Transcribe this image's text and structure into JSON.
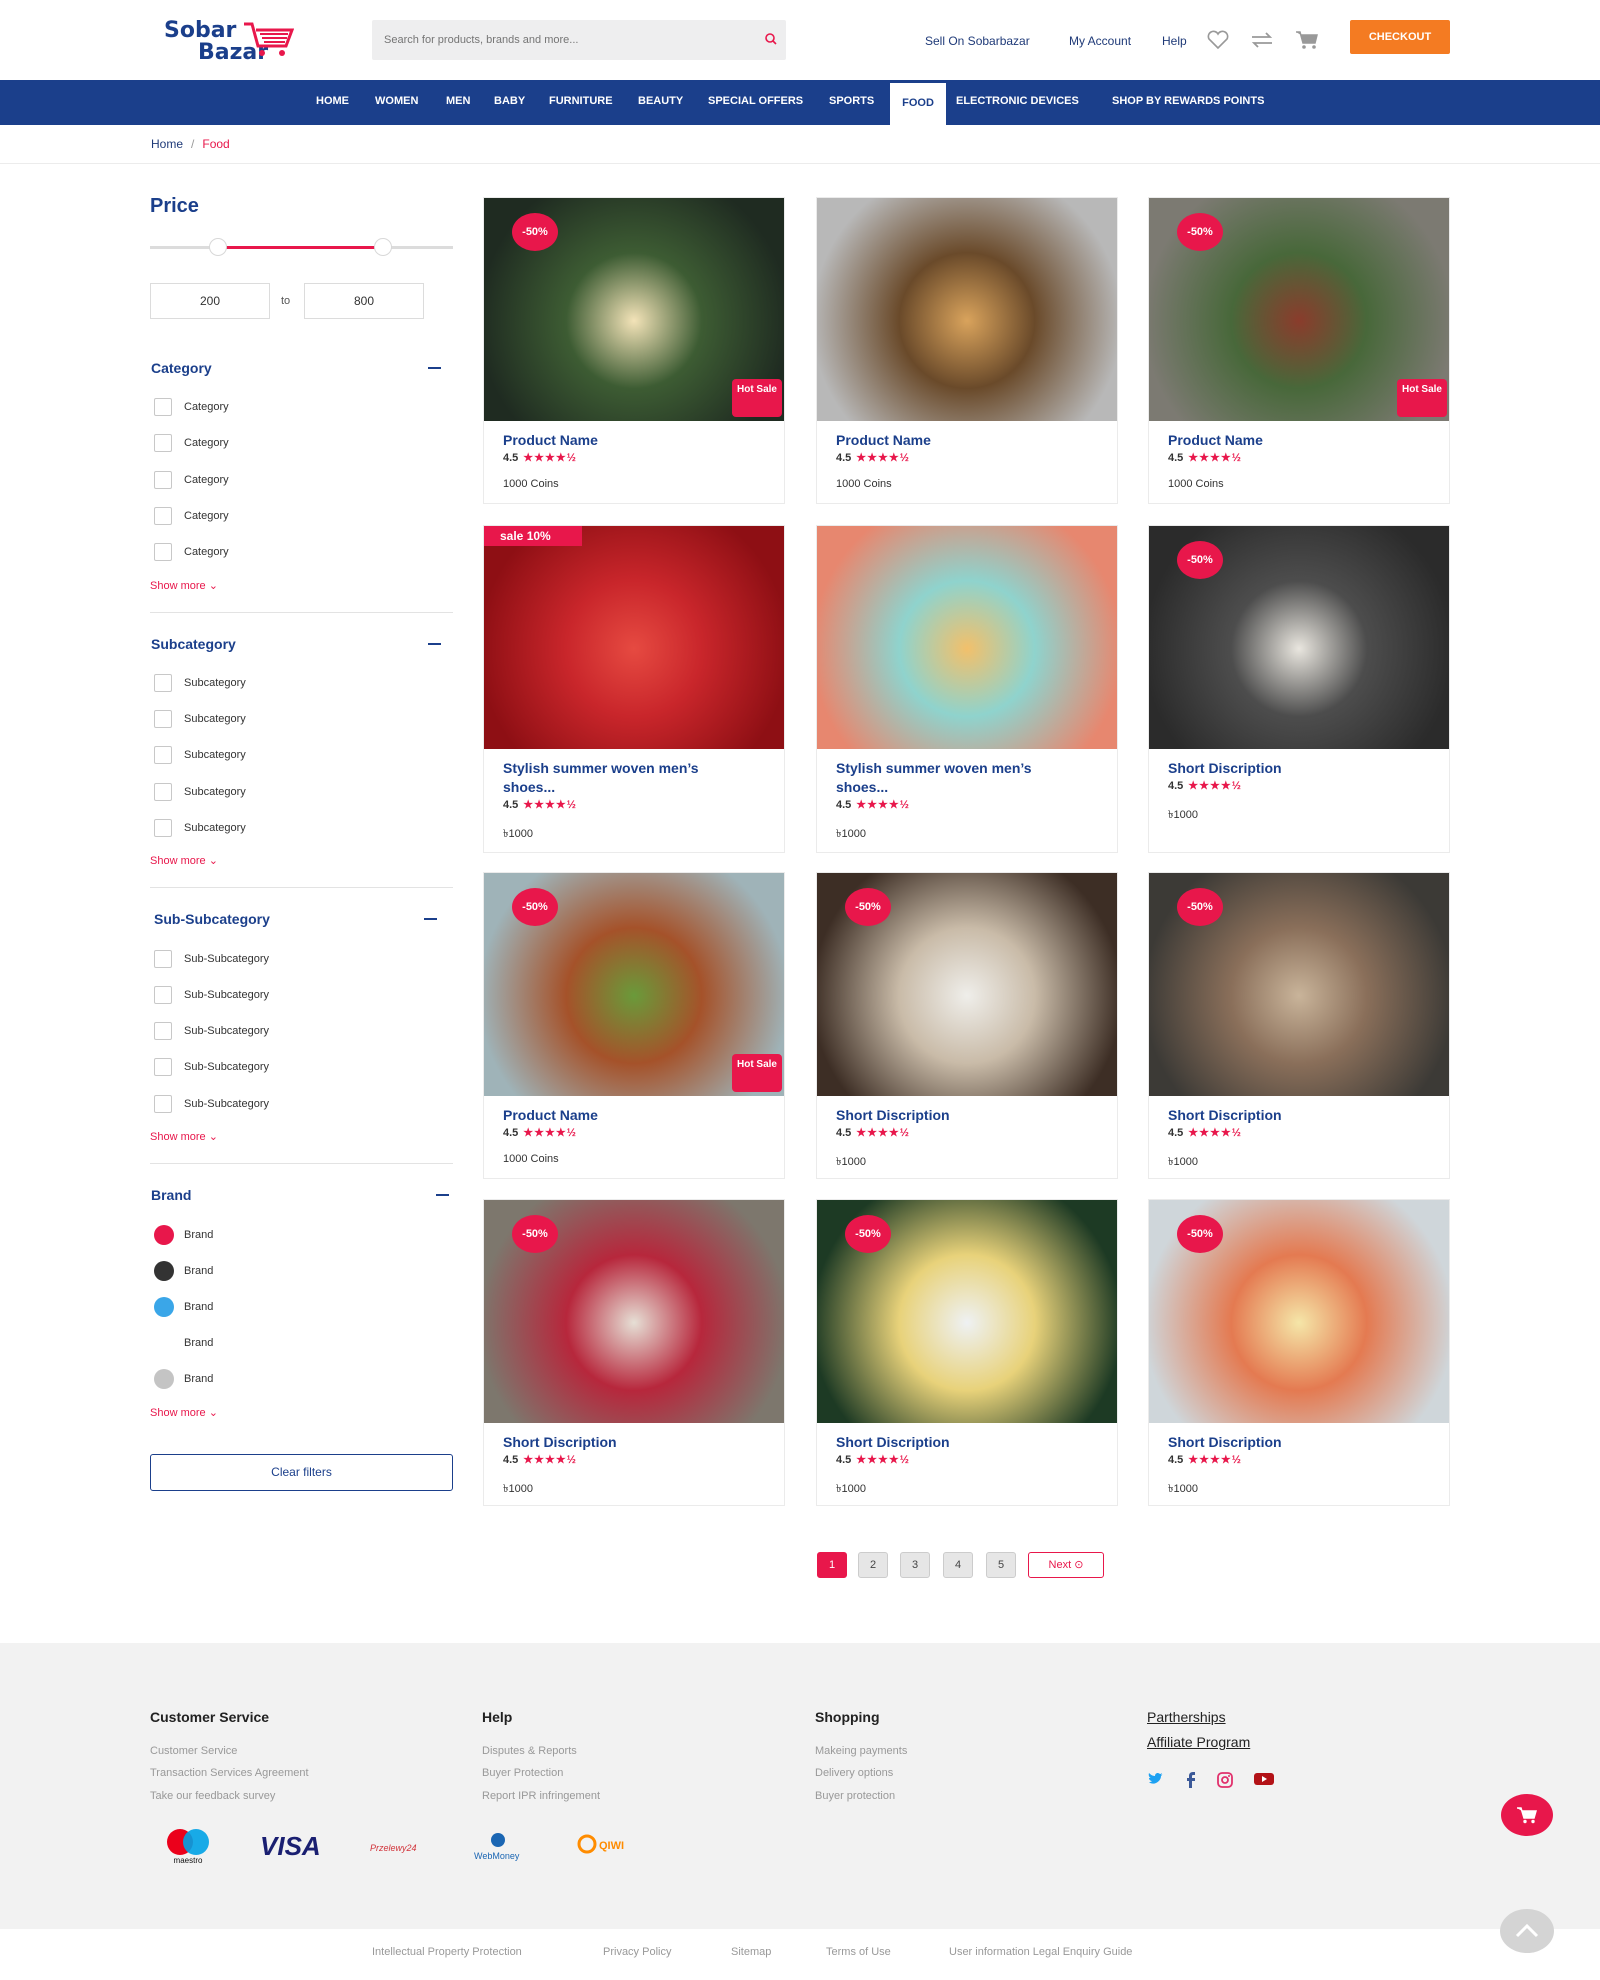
{
  "brand": {
    "line1": "Sobar",
    "line2": "Bazar"
  },
  "search": {
    "placeholder": "Search for products, brands and more..."
  },
  "toplinks": {
    "sell": "Sell On Sobarbazar",
    "account": "My Account",
    "help": "Help"
  },
  "checkout_label": "CHECKOUT",
  "nav": [
    "HOME",
    "WOMEN",
    "MEN",
    "BABY",
    "FURNITURE",
    "BEAUTY",
    "SPECIAL OFFERS",
    "SPORTS",
    "FOOD",
    "ELECTRONIC DEVICES",
    "SHOP BY REWARDS POINTS"
  ],
  "nav_active": "FOOD",
  "breadcrumb": {
    "home": "Home",
    "sep": "/",
    "current": "Food"
  },
  "filters": {
    "price": {
      "title": "Price",
      "min": "200",
      "max": "800",
      "to": "to",
      "range_low": 0.27,
      "range_high": 0.79
    },
    "category": {
      "title": "Category",
      "items": [
        "Category",
        "Category",
        "Category",
        "Category",
        "Category"
      ],
      "more": "Show more"
    },
    "subcategory": {
      "title": "Subcategory",
      "items": [
        "Subcategory",
        "Subcategory",
        "Subcategory",
        "Subcategory",
        "Subcategory"
      ],
      "more": "Show more"
    },
    "subsub": {
      "title": "Sub-Subcategory",
      "items": [
        "Sub-Subcategory",
        "Sub-Subcategory",
        "Sub-Subcategory",
        "Sub-Subcategory",
        "Sub-Subcategory"
      ],
      "more": "Show more"
    },
    "brand": {
      "title": "Brand",
      "items": [
        {
          "label": "Brand",
          "color": "#e8174b"
        },
        {
          "label": "Brand",
          "color": "#333333"
        },
        {
          "label": "Brand",
          "color": "#3aa6e8"
        },
        {
          "label": "Brand",
          "color": "#ffffff"
        },
        {
          "label": "Brand",
          "color": "#c4c4c4"
        }
      ],
      "more": "Show more"
    },
    "clear": "Clear filters"
  },
  "products": [
    {
      "name": "Product Name",
      "rating": "4.5",
      "price": "1000 Coins",
      "badge": "-50%",
      "hot": "Hot Sale",
      "image": "egg-salad-plate"
    },
    {
      "name": "Product Name",
      "rating": "4.5",
      "price": "1000 Coins",
      "badge": "",
      "hot": "",
      "image": "grilled-pork-chop"
    },
    {
      "name": "Product Name",
      "rating": "4.5",
      "price": "1000 Coins",
      "badge": "-50%",
      "hot": "Hot Sale",
      "image": "beef-salad-bowls"
    },
    {
      "name": "Stylish summer woven men’s shoes...",
      "rating": "4.5",
      "price": "৳1000",
      "badge": "sale 10%",
      "hot": "",
      "image": "strawberries"
    },
    {
      "name": "Stylish summer woven men’s shoes...",
      "rating": "4.5",
      "price": "৳1000",
      "badge": "",
      "hot": "",
      "image": "macarons"
    },
    {
      "name": "Short Discription",
      "rating": "4.5",
      "price": "৳1000",
      "badge": "-50%",
      "hot": "",
      "image": "pumpkins-still-life"
    },
    {
      "name": "Product Name",
      "rating": "4.5",
      "price": "1000 Coins",
      "badge": "-50%",
      "hot": "Hot Sale",
      "image": "burger"
    },
    {
      "name": "Short Discription",
      "rating": "4.5",
      "price": "৳1000",
      "badge": "-50%",
      "hot": "",
      "image": "coffee-mug"
    },
    {
      "name": "Short Discription",
      "rating": "4.5",
      "price": "৳1000",
      "badge": "-50%",
      "hot": "",
      "image": "cookie-napkin"
    },
    {
      "name": "Short Discription",
      "rating": "4.5",
      "price": "৳1000",
      "badge": "-50%",
      "hot": "",
      "image": "berry-drinks"
    },
    {
      "name": "Short Discription",
      "rating": "4.5",
      "price": "৳1000",
      "badge": "-50%",
      "hot": "",
      "image": "lime-cocktail"
    },
    {
      "name": "Short Discription",
      "rating": "4.5",
      "price": "৳1000",
      "badge": "-50%",
      "hot": "",
      "image": "fruit-lemonade"
    }
  ],
  "stars": "★★★★½",
  "pagination": {
    "pages": [
      "1",
      "2",
      "3",
      "4",
      "5"
    ],
    "current": "1",
    "next": "Next"
  },
  "footer": {
    "customer_service": {
      "title": "Customer Service",
      "links": [
        "Customer Service",
        "Transaction Services Agreement",
        "Take our feedback survey"
      ]
    },
    "help": {
      "title": "Help",
      "links": [
        "Disputes & Reports",
        "Buyer Protection",
        "Report IPR infringement"
      ]
    },
    "shopping": {
      "title": "Shopping",
      "links": [
        "Makeing payments",
        "Delivery options",
        "Buyer protection"
      ]
    },
    "partner": {
      "links": [
        "Partherships",
        "Affiliate Program"
      ]
    },
    "social": [
      "twitter-icon",
      "facebook-icon",
      "instagram-icon",
      "youtube-icon"
    ],
    "payments": [
      "maestro",
      "VISA",
      "Przelewy24",
      "WebMoney",
      "QIWI"
    ]
  },
  "bottom_links": [
    "Intellectual Property Protection",
    "Privacy Policy",
    "Sitemap",
    "Terms of Use",
    "User information Legal Enquiry Guide"
  ],
  "colors": {
    "primary": "#1b3f8b",
    "accent": "#e8174b",
    "checkout": "#f47b22"
  }
}
